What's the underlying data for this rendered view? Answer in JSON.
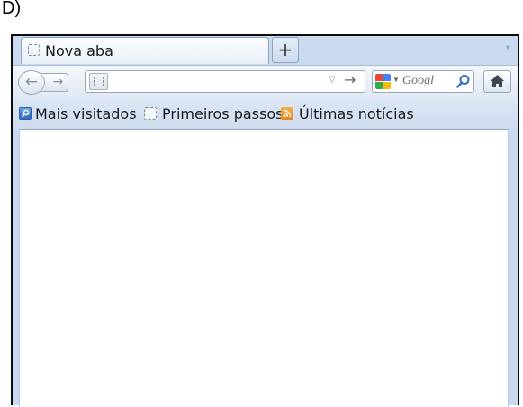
{
  "question_label": "D)",
  "tab": {
    "title": "Nova aba",
    "new_tab_symbol": "+",
    "tabs_menu_symbol": "▾"
  },
  "nav": {
    "back_symbol": "←",
    "forward_symbol": "→",
    "url": {
      "value": "",
      "placeholder": "",
      "history_symbol": "▽",
      "go_symbol": "→"
    },
    "search": {
      "engine": "Google",
      "text": "Googl",
      "engine_colors": [
        "#ea4335",
        "#4285f4",
        "#34a853",
        "#fbbc05"
      ]
    }
  },
  "bookmarks": [
    {
      "label": "Mais visitados",
      "icon": "search-folder-icon"
    },
    {
      "label": "Primeiros passos",
      "icon": "blank-page-icon"
    },
    {
      "label": "Últimas notícias",
      "icon": "rss-feed-icon"
    }
  ],
  "colors": {
    "chrome": "#c9daf0",
    "accent": "#3b6fb6"
  }
}
